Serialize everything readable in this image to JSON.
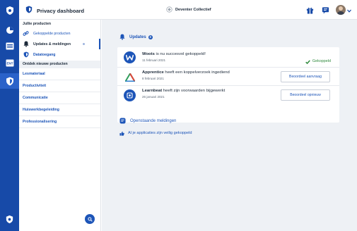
{
  "header": {
    "app_title": "Privacy dashboard",
    "organization": "Deventer Collectief"
  },
  "sidebar": {
    "section_title": "Jullie producten",
    "items": [
      {
        "label": "Gekoppelde producten",
        "icon": "link-icon"
      },
      {
        "label": "Updates & meldingen",
        "icon": "bell-icon"
      },
      {
        "label": "Datatoegang",
        "icon": "shield-icon"
      }
    ],
    "discover_title": "Ontdek nieuwe producten",
    "categories": [
      "Lesmateriaal",
      "Productiviteit",
      "Communicatie",
      "Huiswerkbegeleiding",
      "Professionalisering"
    ]
  },
  "main": {
    "updates_title": "Updates",
    "updates_count": "3",
    "updates": [
      {
        "app": "Woots",
        "text": " is nu succesvol gekoppeld!",
        "date": "11 februari 2021",
        "status": "Gekoppeld",
        "logo_color": "#1d55b8"
      },
      {
        "app": "Apprentice",
        "text": " heeft een koppelverzoek ingediend",
        "date": "8 februari 2021",
        "action": "Beoordeel aanvraag",
        "logo_color": "#ffffff"
      },
      {
        "app": "Learnbeat",
        "text": " heeft zijn voorwaarden bijgewerkt",
        "date": "26 januari 2021",
        "action": "Beoordeel opnieuw",
        "logo_color": "#1d55b8"
      }
    ],
    "pending_title": "Openstaande meldingen",
    "all_ok_text": "Al je applicaties zijn veilig gekoppeld"
  },
  "colors": {
    "brand_blue": "#174aa8",
    "link_blue": "#1d55b8",
    "success_green": "#2f8a3d",
    "main_bg": "#eef1f5"
  }
}
